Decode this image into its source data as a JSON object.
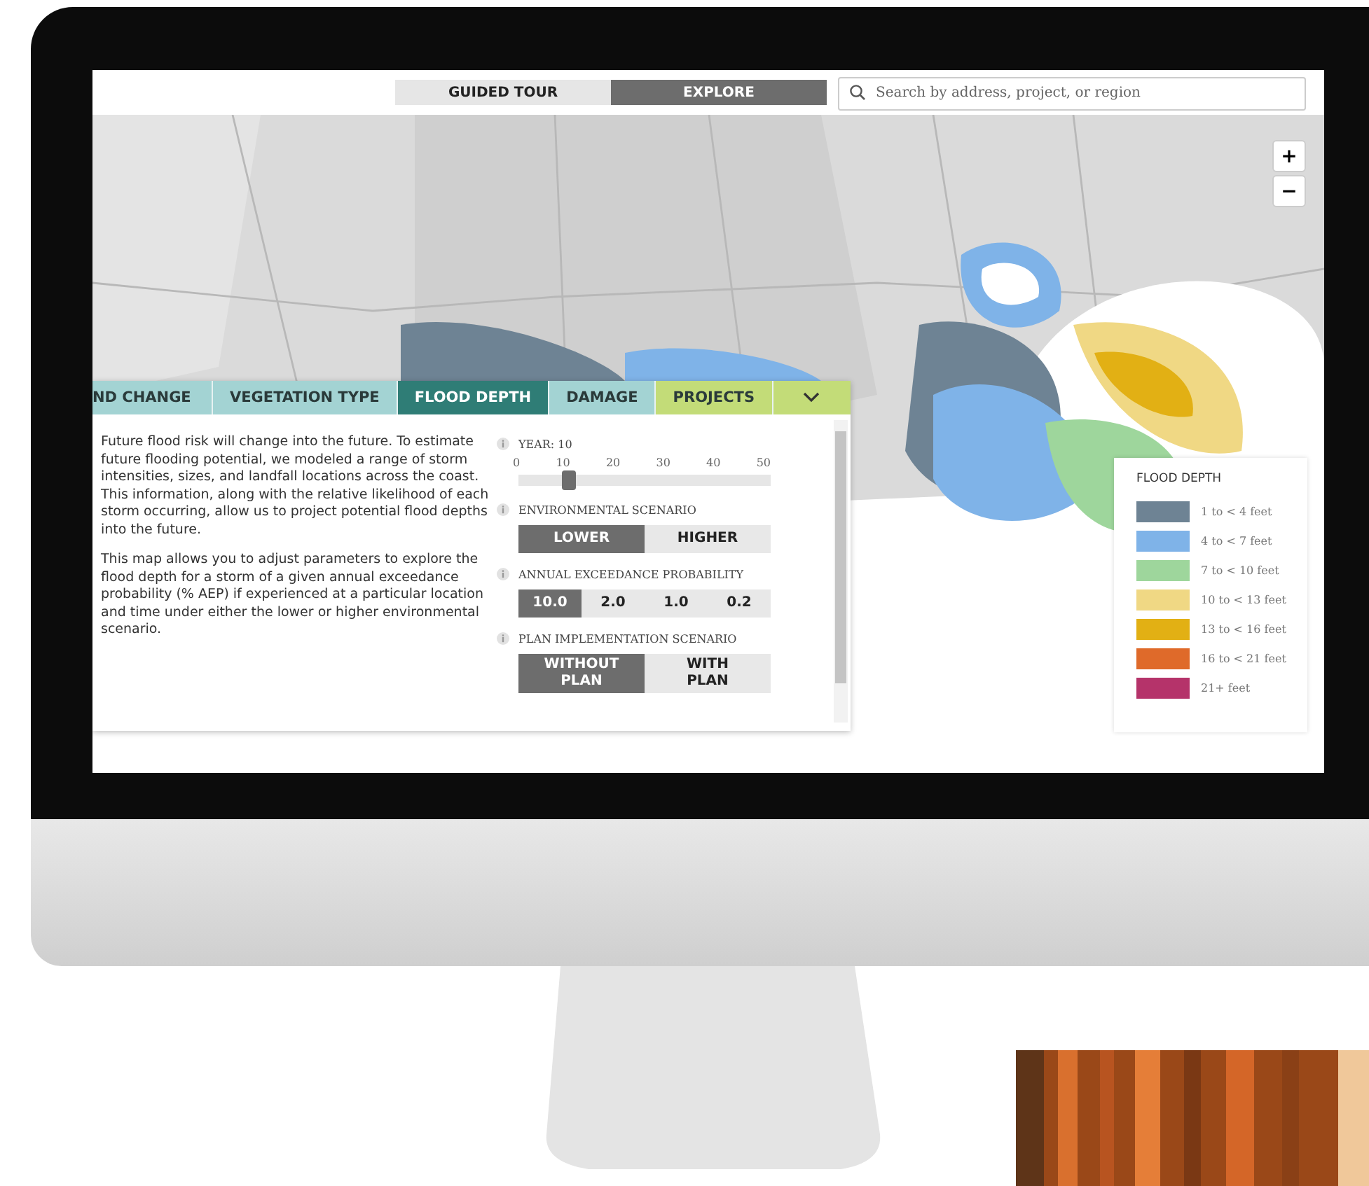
{
  "top_bar": {
    "modes": [
      {
        "label": "GUIDED TOUR",
        "selected": false
      },
      {
        "label": "EXPLORE",
        "selected": true
      }
    ],
    "search": {
      "placeholder": "Search by address, project, or region"
    }
  },
  "map": {
    "zoom_controls": [
      "+",
      "−"
    ]
  },
  "panel": {
    "tabs": [
      {
        "label": "ND CHANGE",
        "selected": false,
        "color": "#a3d3d3"
      },
      {
        "label": "VEGETATION TYPE",
        "selected": false,
        "color": "#a3d3d3"
      },
      {
        "label": "FLOOD DEPTH",
        "selected": true,
        "color": "#2f7d76"
      },
      {
        "label": "DAMAGE",
        "selected": false,
        "color": "#a3d3d3"
      },
      {
        "label": "PROJECTS",
        "selected": false,
        "color": "#c3dc78"
      }
    ],
    "description": [
      "Future flood risk will change into the future. To estimate future flooding potential, we modeled a range of storm intensities, sizes, and landfall locations across the coast. This information, along with the relative likelihood of each storm occurring, allow us to project potential flood depths into the future.",
      "This map allows you to adjust parameters to explore the flood depth for a storm of a given annual exceedance probability (% AEP) if experienced at a particular location and time under either the lower or higher environmental scenario."
    ],
    "year": {
      "label": "YEAR: 10",
      "ticks": [
        "0",
        "10",
        "20",
        "30",
        "40",
        "50"
      ],
      "level": 0.2
    },
    "controls": [
      {
        "label": "ENVIRONMENTAL SCENARIO",
        "options": [
          {
            "label": "LOWER",
            "selected": true
          },
          {
            "label": "HIGHER",
            "selected": false
          }
        ]
      },
      {
        "label": "ANNUAL EXCEEDANCE PROBABILITY",
        "options": [
          {
            "label": "10.0",
            "selected": true
          },
          {
            "label": "2.0",
            "selected": false
          },
          {
            "label": "1.0",
            "selected": false
          },
          {
            "label": "0.2",
            "selected": false
          }
        ]
      },
      {
        "label": "PLAN IMPLEMENTATION SCENARIO",
        "options": [
          {
            "label": "WITHOUT PLAN",
            "selected": true
          },
          {
            "label": "WITH PLAN",
            "selected": false
          }
        ]
      }
    ]
  },
  "legend": {
    "title": "FLOOD DEPTH",
    "items": [
      {
        "label": "1 to < 4 feet",
        "color": "#6e8394"
      },
      {
        "label": "4 to < 7 feet",
        "color": "#7fb3e8"
      },
      {
        "label": "7 to < 10 feet",
        "color": "#9ed69c"
      },
      {
        "label": "10 to < 13 feet",
        "color": "#f0d884"
      },
      {
        "label": "13 to < 16 feet",
        "color": "#e2b014"
      },
      {
        "label": "16 to < 21 feet",
        "color": "#df6a2a"
      },
      {
        "label": "21+ feet",
        "color": "#b5336a"
      }
    ]
  }
}
